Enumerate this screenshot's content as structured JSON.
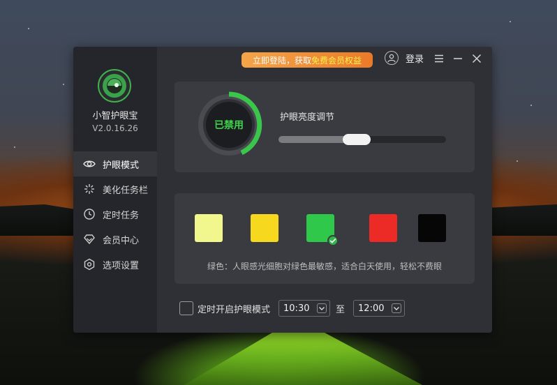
{
  "app": {
    "name": "小智护眼宝",
    "version": "V2.0.16.26"
  },
  "titlebar": {
    "promo_prefix": "立即登陆，获取",
    "promo_highlight": "免费会员权益",
    "login_label": "登录",
    "menu_icon": "menu-icon",
    "minimize_icon": "minimize-icon",
    "close_icon": "close-icon"
  },
  "sidebar": {
    "items": [
      {
        "label": "护眼模式",
        "icon": "eye-icon",
        "active": true
      },
      {
        "label": "美化任务栏",
        "icon": "sparkle-icon",
        "active": false
      },
      {
        "label": "定时任务",
        "icon": "clock-icon",
        "active": false
      },
      {
        "label": "会员中心",
        "icon": "diamond-icon",
        "active": false
      },
      {
        "label": "选项设置",
        "icon": "settings-icon",
        "active": false
      }
    ]
  },
  "eye_protection": {
    "status_label": "已禁用",
    "brightness_title": "护眼亮度调节",
    "brightness_level": 0.46
  },
  "color_modes": {
    "swatches": [
      {
        "name": "light-yellow",
        "color": "#f1f78d",
        "selected": false
      },
      {
        "name": "yellow",
        "color": "#f6d81e",
        "selected": false
      },
      {
        "name": "green",
        "color": "#2fc84a",
        "selected": true
      },
      {
        "name": "red",
        "color": "#ec2b26",
        "selected": false
      },
      {
        "name": "black",
        "color": "#060606",
        "selected": false
      }
    ],
    "description": "绿色：人眼感光细胞对绿色最敏感，适合白天使用，轻松不费眼"
  },
  "schedule": {
    "checkbox_label": "定时开启护眼模式",
    "start_time": "10:30",
    "separator": "至",
    "end_time": "12:00"
  },
  "colors": {
    "accent_green": "#3fd24c",
    "promo_orange": "#ea7a2a",
    "promo_highlight": "#fff14a"
  }
}
